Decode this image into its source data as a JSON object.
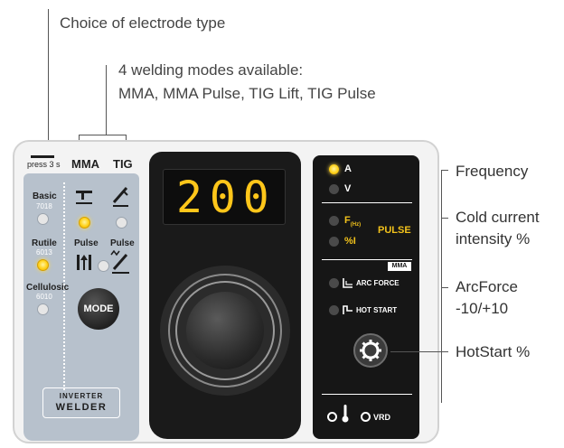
{
  "annotations": {
    "electrode_choice": "Choice of electrode type",
    "modes_line1": "4 welding modes available:",
    "modes_line2": "MMA, MMA Pulse, TIG Lift, TIG Pulse",
    "frequency": "Frequency",
    "cold_current_line1": "Cold current",
    "cold_current_line2": "intensity %",
    "arcforce_line1": "ArcForce",
    "arcforce_line2": "-10/+10",
    "hotstart": "HotStart %"
  },
  "panel": {
    "press_label": "press 3 s",
    "mma_label": "MMA",
    "tig_label": "TIG",
    "electrodes": [
      {
        "name": "Basic",
        "code": "7018",
        "active": false
      },
      {
        "name": "Rutile",
        "code": "6013",
        "active": true
      },
      {
        "name": "Cellulosic",
        "code": "6010",
        "active": false
      }
    ],
    "mma_pulse_label": "Pulse",
    "tig_pulse_label": "Pulse",
    "mode_button": "MODE",
    "badge_line1": "INVERTER",
    "badge_line2": "WELDER",
    "display_value": "200",
    "right": {
      "a_label": "A",
      "v_label": "V",
      "f_label": "F",
      "f_unit": "(Hz)",
      "pct_label": "%I",
      "pulse_label": "PULSE",
      "mma_tag": "MMA",
      "arcforce_label": "ARC FORCE",
      "hotstart_label": "HOT START",
      "vrd_label": "VRD"
    }
  },
  "colors": {
    "led_on": "#ffd21a",
    "display_digits": "#ffc61a",
    "panel_blue": "#b7c1cc",
    "pulse_text": "#f2c21b"
  }
}
